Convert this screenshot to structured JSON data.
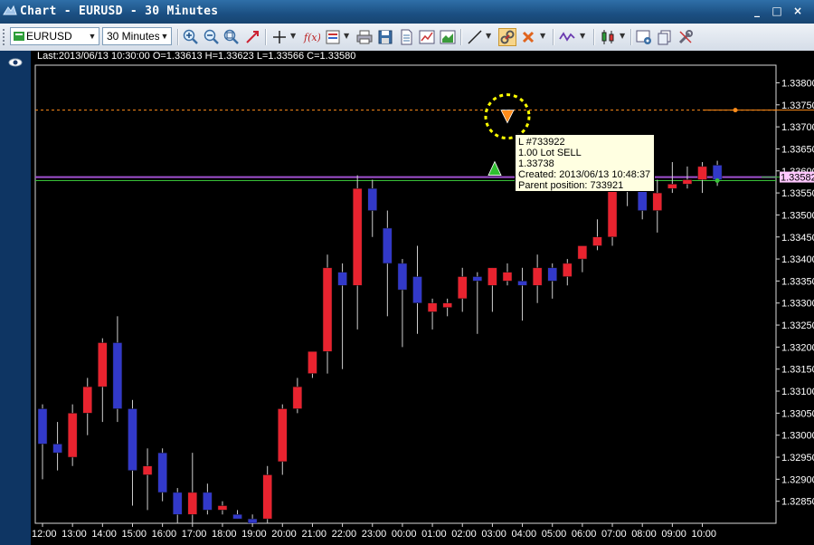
{
  "window": {
    "title": "Chart - EURUSD - 30 Minutes",
    "buttons": {
      "minimize": "_",
      "restore": "□",
      "close": "×"
    }
  },
  "toolbar": {
    "symbol": "EURUSD",
    "timeframe": "30 Minutes"
  },
  "chart": {
    "info_line": "Last:2013/06/13 10:30:00 O=1.33613 H=1.33623 L=1.33566 C=1.33580",
    "current_price_label": "1.33582",
    "tooltip": {
      "line1": "L #733922",
      "line2": "1.00 Lot SELL",
      "line3": "1.33738",
      "line4": "Created: 2013/06/13 10:48:37",
      "line5": "Parent position: 733921"
    },
    "colors": {
      "background": "#000000",
      "grid": "#3a3a3a",
      "bull": "#e8232f",
      "bear": "#3239c9",
      "order_line": "#ff8c1a",
      "position_line": "#a050d0",
      "bid_line": "#38c038",
      "price_label_bg": "#ffc8ff"
    }
  },
  "chart_data": {
    "type": "candlestick",
    "ylim": [
      1.328,
      1.3384
    ],
    "y_ticks": [
      "1.33800",
      "1.33750",
      "1.33700",
      "1.33650",
      "1.33600",
      "1.33550",
      "1.33500",
      "1.33450",
      "1.33400",
      "1.33350",
      "1.33300",
      "1.33250",
      "1.33200",
      "1.33150",
      "1.33100",
      "1.33050",
      "1.33000",
      "1.32950",
      "1.32900",
      "1.32850"
    ],
    "x_labels": [
      "12:00",
      "13:00",
      "14:00",
      "15:00",
      "16:00",
      "17:00",
      "18:00",
      "19:00",
      "20:00",
      "21:00",
      "22:00",
      "23:00",
      "00:00",
      "01:00",
      "02:00",
      "03:00",
      "04:00",
      "05:00",
      "06:00",
      "07:00",
      "08:00",
      "09:00",
      "10:00"
    ],
    "candles": [
      {
        "o": 1.3306,
        "h": 1.3307,
        "l": 1.329,
        "c": 1.3298
      },
      {
        "o": 1.3298,
        "h": 1.3303,
        "l": 1.3292,
        "c": 1.3296
      },
      {
        "o": 1.3295,
        "h": 1.3307,
        "l": 1.3293,
        "c": 1.3305
      },
      {
        "o": 1.3305,
        "h": 1.3313,
        "l": 1.33,
        "c": 1.3311
      },
      {
        "o": 1.3311,
        "h": 1.3322,
        "l": 1.3303,
        "c": 1.3321
      },
      {
        "o": 1.3321,
        "h": 1.3327,
        "l": 1.3303,
        "c": 1.3306
      },
      {
        "o": 1.3306,
        "h": 1.3308,
        "l": 1.3284,
        "c": 1.3292
      },
      {
        "o": 1.3291,
        "h": 1.3297,
        "l": 1.3283,
        "c": 1.3293
      },
      {
        "o": 1.3296,
        "h": 1.3297,
        "l": 1.3285,
        "c": 1.3287
      },
      {
        "o": 1.3287,
        "h": 1.3288,
        "l": 1.328,
        "c": 1.3282
      },
      {
        "o": 1.3282,
        "h": 1.3296,
        "l": 1.328,
        "c": 1.3287
      },
      {
        "o": 1.3287,
        "h": 1.3289,
        "l": 1.3282,
        "c": 1.3283
      },
      {
        "o": 1.3283,
        "h": 1.3285,
        "l": 1.3282,
        "c": 1.3284
      },
      {
        "o": 1.3282,
        "h": 1.3283,
        "l": 1.3281,
        "c": 1.3281
      },
      {
        "o": 1.3281,
        "h": 1.3282,
        "l": 1.328,
        "c": 1.328
      },
      {
        "o": 1.3281,
        "h": 1.3293,
        "l": 1.3279,
        "c": 1.3291
      },
      {
        "o": 1.3294,
        "h": 1.3307,
        "l": 1.3291,
        "c": 1.3306
      },
      {
        "o": 1.3306,
        "h": 1.3313,
        "l": 1.3305,
        "c": 1.3311
      },
      {
        "o": 1.3314,
        "h": 1.3319,
        "l": 1.3313,
        "c": 1.3319
      },
      {
        "o": 1.3319,
        "h": 1.3341,
        "l": 1.3314,
        "c": 1.3338
      },
      {
        "o": 1.3337,
        "h": 1.3339,
        "l": 1.3315,
        "c": 1.3334
      },
      {
        "o": 1.3334,
        "h": 1.3359,
        "l": 1.3324,
        "c": 1.3356
      },
      {
        "o": 1.3356,
        "h": 1.3358,
        "l": 1.3345,
        "c": 1.3351
      },
      {
        "o": 1.3347,
        "h": 1.3351,
        "l": 1.3327,
        "c": 1.3339
      },
      {
        "o": 1.3339,
        "h": 1.334,
        "l": 1.332,
        "c": 1.3333
      },
      {
        "o": 1.3336,
        "h": 1.3343,
        "l": 1.3323,
        "c": 1.333
      },
      {
        "o": 1.3328,
        "h": 1.3331,
        "l": 1.3324,
        "c": 1.333
      },
      {
        "o": 1.3329,
        "h": 1.3331,
        "l": 1.3327,
        "c": 1.333
      },
      {
        "o": 1.3331,
        "h": 1.3338,
        "l": 1.3328,
        "c": 1.3336
      },
      {
        "o": 1.3336,
        "h": 1.3337,
        "l": 1.3323,
        "c": 1.3335
      },
      {
        "o": 1.3334,
        "h": 1.3338,
        "l": 1.3328,
        "c": 1.3338
      },
      {
        "o": 1.3335,
        "h": 1.3339,
        "l": 1.3334,
        "c": 1.3337
      },
      {
        "o": 1.3335,
        "h": 1.3338,
        "l": 1.3326,
        "c": 1.3334
      },
      {
        "o": 1.3334,
        "h": 1.3341,
        "l": 1.333,
        "c": 1.3338
      },
      {
        "o": 1.3338,
        "h": 1.3339,
        "l": 1.3331,
        "c": 1.3335
      },
      {
        "o": 1.3336,
        "h": 1.334,
        "l": 1.3334,
        "c": 1.3339
      },
      {
        "o": 1.334,
        "h": 1.3343,
        "l": 1.3337,
        "c": 1.3343
      },
      {
        "o": 1.3343,
        "h": 1.3349,
        "l": 1.3342,
        "c": 1.3345
      },
      {
        "o": 1.3345,
        "h": 1.3357,
        "l": 1.3343,
        "c": 1.3356
      },
      {
        "o": 1.3356,
        "h": 1.3363,
        "l": 1.3352,
        "c": 1.336
      },
      {
        "o": 1.3359,
        "h": 1.336,
        "l": 1.3349,
        "c": 1.3351
      },
      {
        "o": 1.3351,
        "h": 1.3358,
        "l": 1.3346,
        "c": 1.3355
      },
      {
        "o": 1.3356,
        "h": 1.3362,
        "l": 1.3355,
        "c": 1.3357
      },
      {
        "o": 1.3357,
        "h": 1.3361,
        "l": 1.3356,
        "c": 1.3358
      },
      {
        "o": 1.3358,
        "h": 1.3362,
        "l": 1.3355,
        "c": 1.3361
      },
      {
        "o": 1.33613,
        "h": 1.33623,
        "l": 1.33566,
        "c": 1.3358
      }
    ],
    "order_line": 1.33738,
    "position_line": 1.33586,
    "bid_line": 1.3358
  }
}
